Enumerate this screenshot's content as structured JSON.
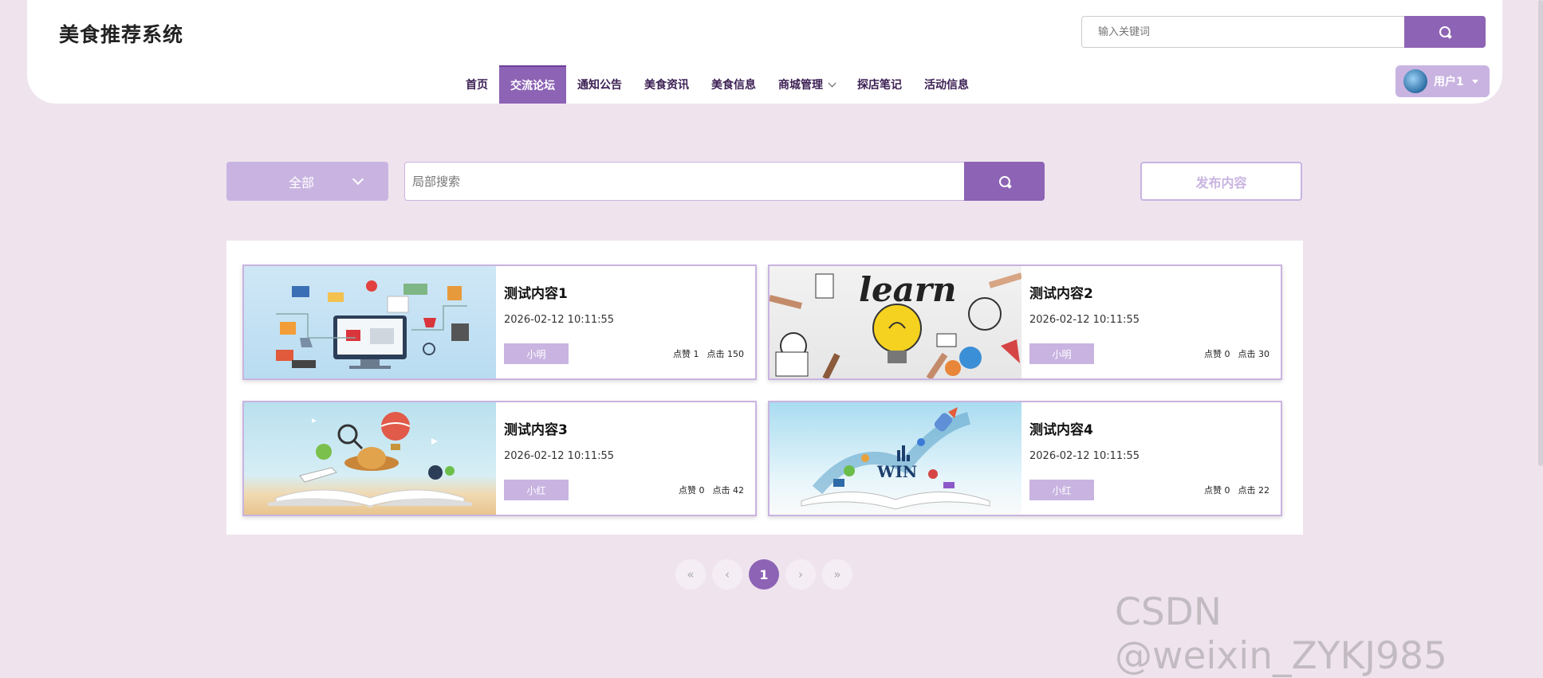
{
  "header": {
    "site_title": "美食推荐系统",
    "search_placeholder": "输入关键词",
    "user_label": "用户1"
  },
  "nav": {
    "items": [
      {
        "label": "首页",
        "active": false
      },
      {
        "label": "交流论坛",
        "active": true
      },
      {
        "label": "通知公告",
        "active": false
      },
      {
        "label": "美食资讯",
        "active": false
      },
      {
        "label": "美食信息",
        "active": false
      },
      {
        "label": "商城管理",
        "active": false,
        "dropdown": true
      },
      {
        "label": "探店笔记",
        "active": false
      },
      {
        "label": "活动信息",
        "active": false
      }
    ]
  },
  "filter": {
    "category": "全部",
    "search_placeholder": "局部搜索",
    "publish_label": "发布内容"
  },
  "posts": [
    {
      "title": "测试内容1",
      "time": "2026-02-12 10:11:55",
      "author": "小明",
      "likes": "点赞 1",
      "clicks": "点击 150"
    },
    {
      "title": "测试内容2",
      "time": "2026-02-12 10:11:55",
      "author": "小明",
      "likes": "点赞 0",
      "clicks": "点击 30"
    },
    {
      "title": "测试内容3",
      "time": "2026-02-12 10:11:55",
      "author": "小红",
      "likes": "点赞 0",
      "clicks": "点击 42"
    },
    {
      "title": "测试内容4",
      "time": "2026-02-12 10:11:55",
      "author": "小红",
      "likes": "点赞 0",
      "clicks": "点击 22"
    }
  ],
  "pagination": {
    "first": "«",
    "prev": "‹",
    "current": "1",
    "next": "›",
    "last": "»"
  },
  "watermark": "CSDN @weixin_ZYKJ985",
  "colors": {
    "accent": "#8d63b5",
    "accent_light": "#c9b4e1",
    "page_bg": "#efe4ee"
  }
}
